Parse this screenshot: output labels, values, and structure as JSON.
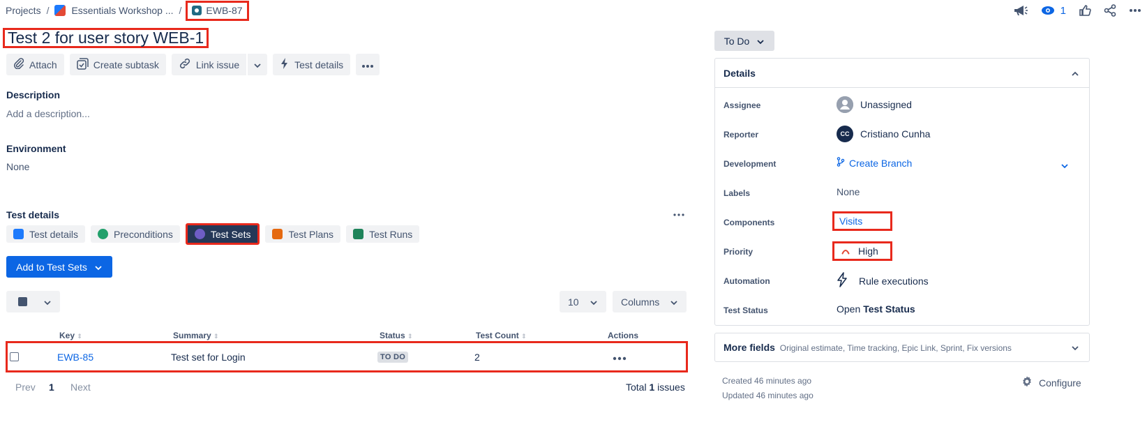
{
  "breadcrumb": {
    "projects": "Projects",
    "separator": "/",
    "project": "Essentials Workshop ...",
    "issue_key": "EWB-87"
  },
  "header_actions": {
    "watch_count": "1"
  },
  "issue": {
    "title": "Test 2 for user story WEB-1"
  },
  "toolbar": {
    "attach": "Attach",
    "create_subtask": "Create subtask",
    "link_issue": "Link issue",
    "test_details": "Test details"
  },
  "description": {
    "label": "Description",
    "placeholder": "Add a description..."
  },
  "environment": {
    "label": "Environment",
    "value": "None"
  },
  "test_details": {
    "label": "Test details",
    "tabs": [
      {
        "label": "Test details",
        "color": "#1d7afc"
      },
      {
        "label": "Preconditions",
        "color": "#22a06b"
      },
      {
        "label": "Test Sets",
        "color": "#6e5dc6"
      },
      {
        "label": "Test Plans",
        "color": "#e56910"
      },
      {
        "label": "Test Runs",
        "color": "#1f845a"
      }
    ],
    "active_tab": "Test Sets",
    "add_button": "Add to Test Sets",
    "page_size": "10",
    "columns_button": "Columns",
    "table": {
      "headers": [
        "Key",
        "Summary",
        "Status",
        "Test Count",
        "Actions"
      ],
      "rows": [
        {
          "key": "EWB-85",
          "summary": "Test set for Login",
          "status": "TO DO",
          "test_count": "2"
        }
      ]
    },
    "pagination": {
      "prev": "Prev",
      "page": "1",
      "next": "Next",
      "total_prefix": "Total",
      "total_count": "1",
      "total_suffix": "issues"
    }
  },
  "status_button": "To Do",
  "details": {
    "title": "Details",
    "fields": [
      {
        "label": "Assignee",
        "value": "Unassigned"
      },
      {
        "label": "Reporter",
        "value": "Cristiano Cunha",
        "initials": "CC"
      },
      {
        "label": "Development",
        "value": "Create Branch"
      },
      {
        "label": "Labels",
        "value": "None"
      },
      {
        "label": "Components",
        "value": "Visits"
      },
      {
        "label": "Priority",
        "value": "High"
      },
      {
        "label": "Automation",
        "value": "Rule executions"
      },
      {
        "label": "Test Status",
        "value_prefix": "Open",
        "value": "Test Status"
      }
    ]
  },
  "more_fields": {
    "label": "More fields",
    "hint": "Original estimate, Time tracking, Epic Link, Sprint, Fix versions"
  },
  "meta": {
    "created": "Created 46 minutes ago",
    "updated": "Updated 46 minutes ago",
    "configure": "Configure"
  },
  "colors": {
    "highlight": "#e8291c",
    "primary": "#0c66e4",
    "active_tab_bg": "#253858",
    "priority_high": "#e34935"
  }
}
